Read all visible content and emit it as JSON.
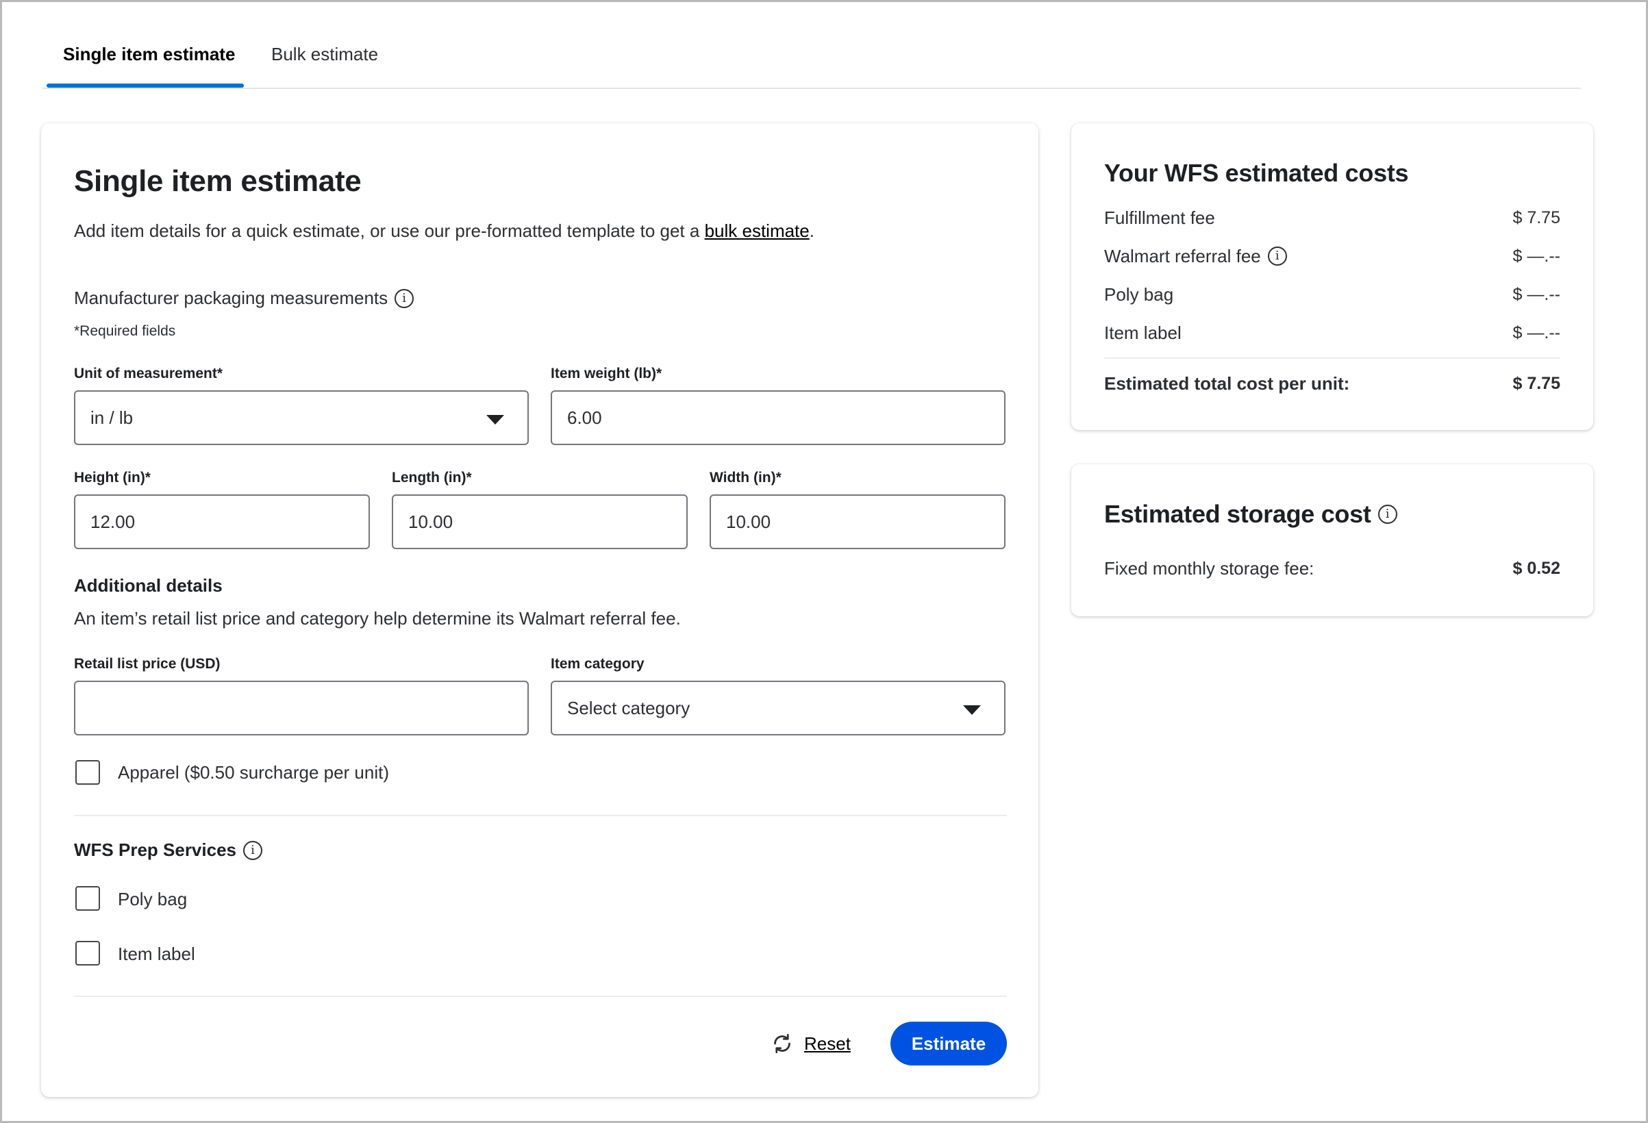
{
  "tabs": [
    {
      "label": "Single item estimate",
      "active": true
    },
    {
      "label": "Bulk estimate",
      "active": false
    }
  ],
  "form": {
    "title": "Single item estimate",
    "intro_before_link": "Add item details for a quick estimate, or use our pre-formatted template to get a ",
    "intro_link": "bulk estimate",
    "intro_after_link": ".",
    "measurements_heading": "Manufacturer packaging measurements",
    "required_note": "*Required fields",
    "unit": {
      "label": "Unit of measurement*",
      "value": "in / lb"
    },
    "weight": {
      "label": "Item weight (lb)*",
      "value": "6.00"
    },
    "height": {
      "label": "Height (in)*",
      "value": "12.00"
    },
    "length": {
      "label": "Length (in)*",
      "value": "10.00"
    },
    "width": {
      "label": "Width (in)*",
      "value": "10.00"
    },
    "additional_heading": "Additional details",
    "additional_desc": "An item’s retail list price and category help determine its Walmart referral fee.",
    "price": {
      "label": "Retail list price (USD)",
      "value": ""
    },
    "category": {
      "label": "Item category",
      "value": "Select category"
    },
    "apparel_label": "Apparel ($0.50 surcharge per unit)",
    "prep_heading": "WFS Prep Services",
    "poly_bag_label": "Poly bag",
    "item_label_label": "Item label",
    "reset_label": "Reset",
    "estimate_label": "Estimate"
  },
  "costs": {
    "title": "Your WFS estimated costs",
    "rows": [
      {
        "label": "Fulfillment fee",
        "value": "$ 7.75"
      },
      {
        "label": "Walmart referral fee",
        "value": "$ —.--"
      },
      {
        "label": "Poly bag",
        "value": "$ —.--"
      },
      {
        "label": "Item label",
        "value": "$ —.--"
      }
    ],
    "total_label": "Estimated total cost per unit:",
    "total_value": "$ 7.75"
  },
  "storage": {
    "title": "Estimated storage cost",
    "fee_label": "Fixed monthly storage fee:",
    "fee_value": "$ 0.52"
  },
  "icons": {
    "info": "info-icon",
    "reset": "refresh-icon",
    "caret": "caret-down-icon"
  },
  "colors": {
    "accent": "#0071dc",
    "button": "#0053e2"
  }
}
